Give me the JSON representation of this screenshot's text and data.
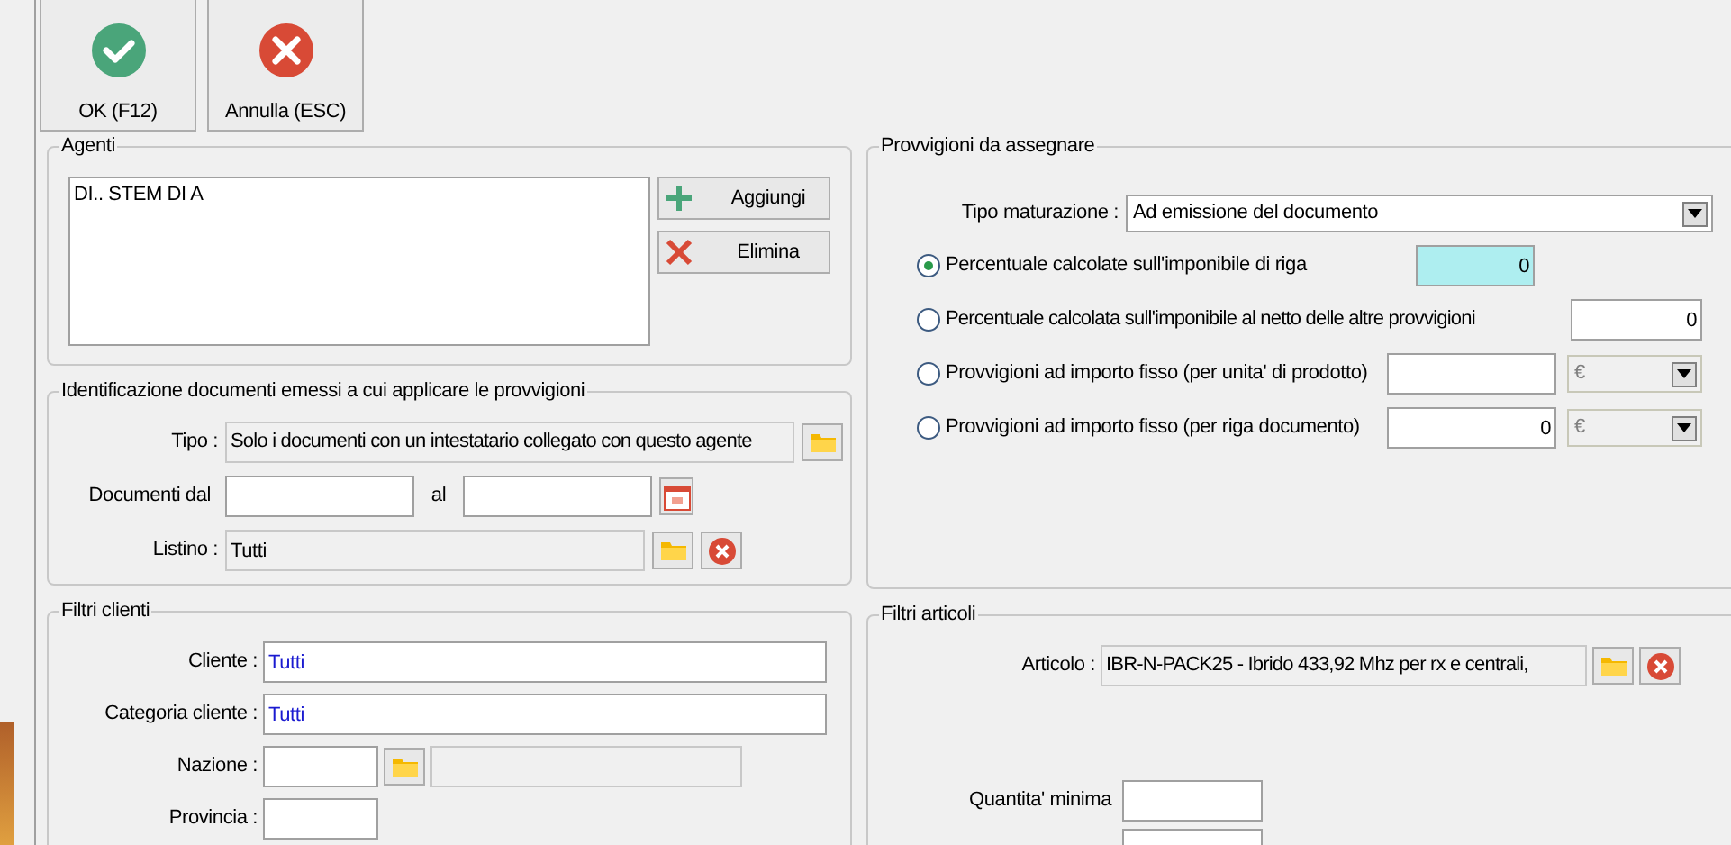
{
  "toolbar": [
    {
      "label": "OK (F12)",
      "kind": "ok"
    },
    {
      "label": "Annulla (ESC)",
      "kind": "cancel"
    }
  ],
  "agenti": {
    "title": "Agenti",
    "items": [
      "DI.. STEM DI A"
    ],
    "buttons": [
      {
        "label": "Aggiungi",
        "kind": "add"
      },
      {
        "label": "Elimina",
        "kind": "delete"
      }
    ]
  },
  "identificazione": {
    "title": "Identificazione documenti emessi a cui applicare le provvigioni",
    "tipo": {
      "label": "Tipo :",
      "value": "Solo i documenti con un intestatario collegato con questo agente"
    },
    "documenti": {
      "label": "Documenti dal",
      "to_label": "al"
    },
    "listino": {
      "label": "Listino :",
      "value": "Tutti"
    }
  },
  "filtri_clienti": {
    "title": "Filtri clienti",
    "cliente": {
      "label": "Cliente :",
      "value": "Tutti"
    },
    "categoria": {
      "label": "Categoria cliente :",
      "value": "Tutti"
    },
    "nazione": {
      "label": "Nazione :"
    },
    "provincia": {
      "label": "Provincia :"
    }
  },
  "provvigioni": {
    "title": "Provvigioni da assegnare",
    "tipo_maturazione": {
      "label": "Tipo maturazione :",
      "value": "Ad emissione del documento"
    },
    "options": [
      {
        "label": "Percentuale calcolate sull'imponibile di riga",
        "selected": true,
        "kind": "short",
        "value": "0"
      },
      {
        "label": "Percentuale calcolata sull'imponibile al netto delle altre provvigioni",
        "selected": false,
        "kind": "wide",
        "value": "0"
      },
      {
        "label": "Provvigioni ad importo fisso (per unita' di prodotto)",
        "selected": false,
        "kind": "currency",
        "currency": "€"
      },
      {
        "label": "Provvigioni ad importo fisso (per riga documento)",
        "selected": false,
        "kind": "currency",
        "value": "0",
        "currency": "€"
      }
    ]
  },
  "filtri_articoli": {
    "title": "Filtri articoli",
    "articolo": {
      "label": "Articolo :",
      "value": "IBR-N-PACK25 - Ibrido 433,92 Mhz per rx e centrali,"
    },
    "quantita": {
      "label": "Quantita' minima"
    }
  }
}
